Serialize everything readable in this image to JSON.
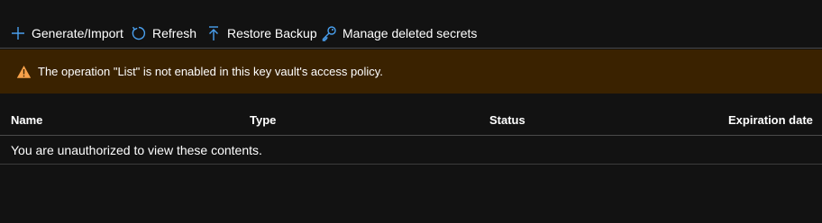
{
  "toolbar": {
    "generate_import": {
      "label": "Generate/Import",
      "icon": "plus-icon"
    },
    "refresh": {
      "label": "Refresh",
      "icon": "refresh-icon"
    },
    "restore_backup": {
      "label": "Restore Backup",
      "icon": "upload-icon"
    },
    "manage_deleted": {
      "label": "Manage deleted secrets",
      "icon": "key-icon"
    }
  },
  "banner": {
    "icon": "warning-icon",
    "message": "The operation \"List\" is not enabled in this key vault's access policy.",
    "background": "#3a2200",
    "icon_color": "#f7a14a"
  },
  "table": {
    "columns": [
      "Name",
      "Type",
      "Status",
      "Expiration date"
    ],
    "empty_message": "You are unauthorized to view these contents."
  },
  "colors": {
    "accent": "#4aa0ef",
    "background": "#121212",
    "text": "#ffffff",
    "divider": "#4a4a4a"
  }
}
